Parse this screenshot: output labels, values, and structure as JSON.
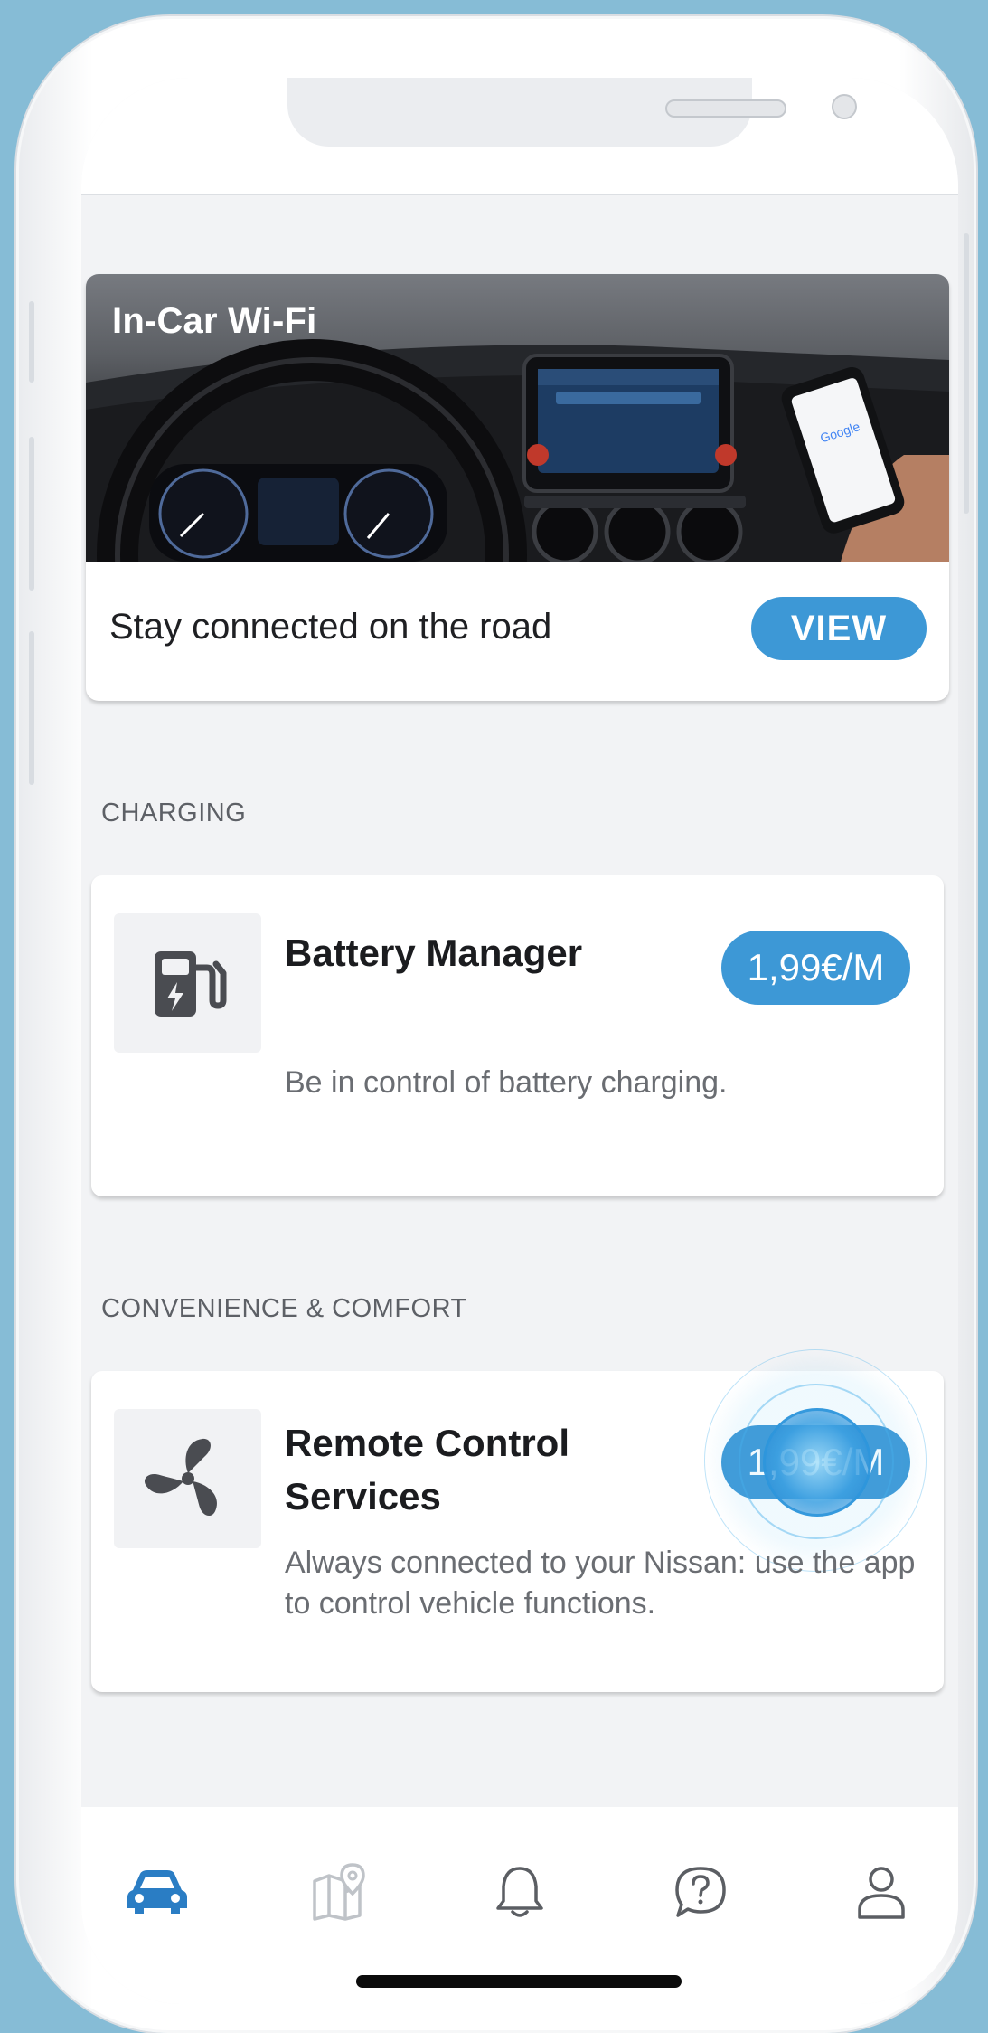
{
  "wifi_card": {
    "title": "In-Car Wi-Fi",
    "tagline": "Stay connected on the road",
    "view_label": "VIEW"
  },
  "sections": {
    "charging": "CHARGING",
    "convenience": "CONVENIENCE & COMFORT"
  },
  "services": {
    "battery": {
      "title": "Battery Manager",
      "price": "1,99€/M",
      "description": "Be in control of battery charging."
    },
    "remote": {
      "title": "Remote Control Services",
      "price": "1,99€/M",
      "description": "Always connected to your Nissan: use the app to control vehicle functions."
    }
  },
  "nav": {
    "items": [
      {
        "name": "car",
        "active": true
      },
      {
        "name": "map",
        "active": false
      },
      {
        "name": "notifications",
        "active": false
      },
      {
        "name": "help",
        "active": false
      },
      {
        "name": "profile",
        "active": false
      }
    ]
  },
  "colors": {
    "accent": "#3d98d6",
    "nav_active": "#2a7dc4",
    "nav_inactive": "#bfc3c8",
    "nav_icon": "#5b5e63",
    "frame_bg": "#86bcd6"
  }
}
